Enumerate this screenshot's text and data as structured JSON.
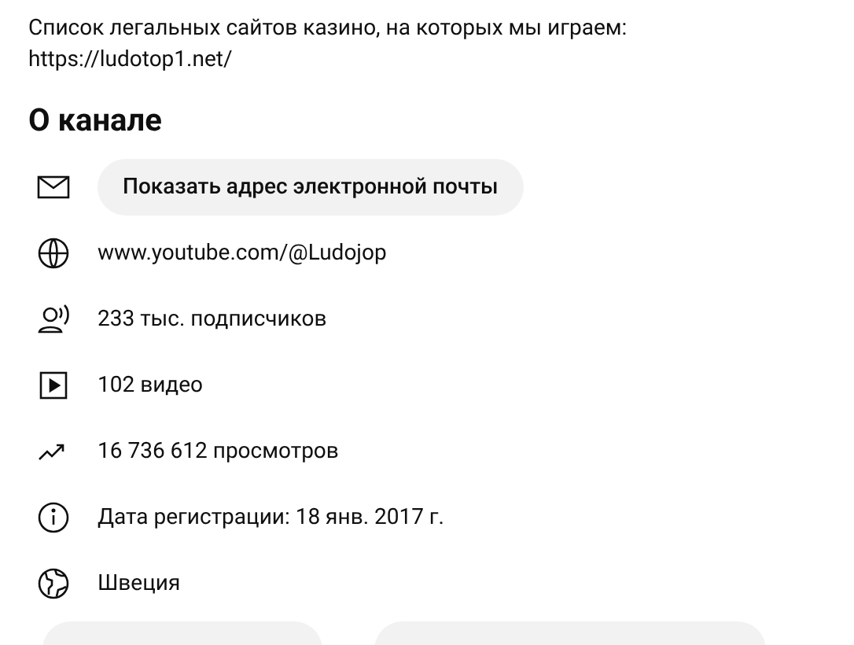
{
  "description": {
    "text": "Список легальных сайтов казино, на которых мы играем:",
    "link": "https://ludotop1.net/"
  },
  "about": {
    "title": "О канале",
    "items": [
      {
        "kind": "email",
        "text": "Показать адрес электронной почты"
      },
      {
        "kind": "website",
        "text": "www.youtube.com/@Ludojop"
      },
      {
        "kind": "subscribers",
        "text": "233 тыс. подписчиков"
      },
      {
        "kind": "videos",
        "text": "102 видео"
      },
      {
        "kind": "views",
        "text": "16 736 612 просмотров"
      },
      {
        "kind": "joined",
        "text": "Дата регистрации: 18 янв. 2017 г."
      },
      {
        "kind": "country",
        "text": "Швеция"
      }
    ]
  }
}
